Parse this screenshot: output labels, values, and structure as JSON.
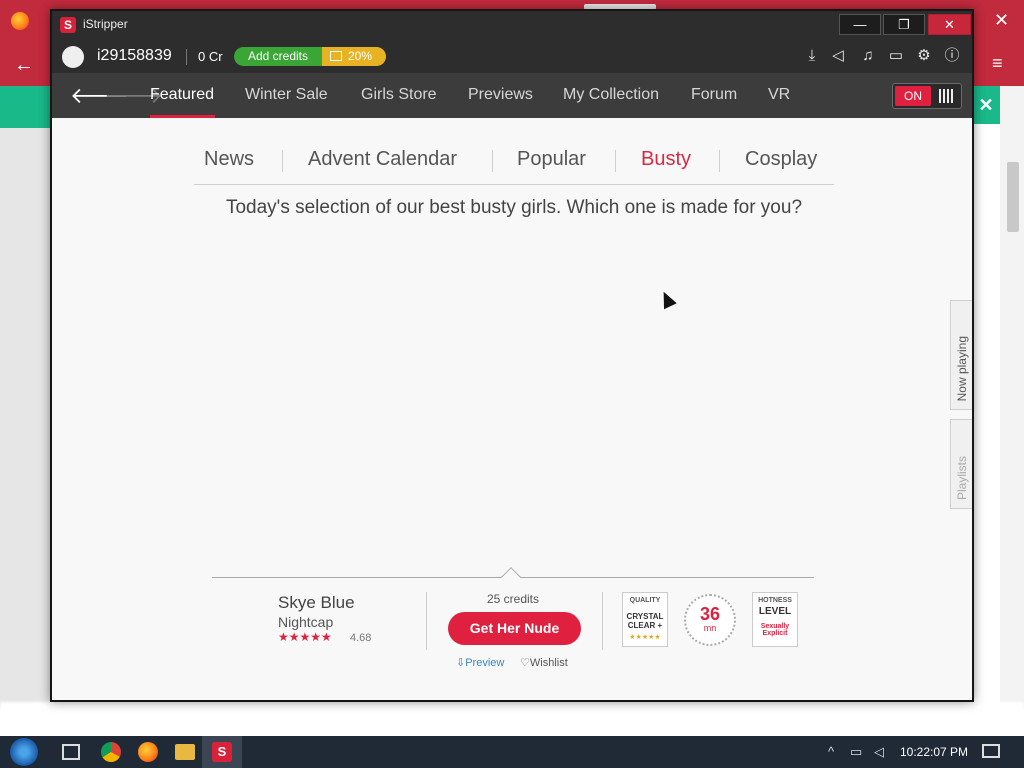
{
  "app": {
    "title": "iStripper",
    "logo_letter": "S",
    "window_controls": {
      "minimize": "—",
      "maximize": "❐",
      "close": "✕"
    }
  },
  "userbar": {
    "username": "i29158839",
    "credits": "0 Cr",
    "add_credits_label": "Add credits",
    "discount_label": "20%",
    "icons": [
      "download-icon",
      "speaker-icon",
      "music-icon",
      "monitor-icon",
      "gear-icon",
      "info-icon"
    ]
  },
  "navbar": {
    "back": "🡐",
    "forward": "🡒",
    "items": [
      {
        "label": "Featured"
      },
      {
        "label": "Winter Sale"
      },
      {
        "label": "Girls Store"
      },
      {
        "label": "Previews"
      },
      {
        "label": "My Collection"
      },
      {
        "label": "Forum"
      },
      {
        "label": "VR"
      }
    ],
    "active_index": 0,
    "toggle_label": "ON"
  },
  "subtabs": {
    "items": [
      {
        "label": "News"
      },
      {
        "label": "Advent Calendar"
      },
      {
        "label": "Popular"
      },
      {
        "label": "Busty"
      },
      {
        "label": "Cosplay"
      }
    ],
    "active_index": 3
  },
  "tagline": "Today's selection of our best busty girls. Which one is made for you?",
  "side_tabs": {
    "now_playing": "Now playing",
    "playlists": "Playlists"
  },
  "card": {
    "name": "Skye Blue",
    "card_title": "Nightcap",
    "stars": "★★★★★",
    "rating": "4.68",
    "price": "25 credits",
    "cta_label": "Get Her Nude",
    "preview_label": "Preview",
    "wishlist_label": "Wishlist",
    "quality_badge": {
      "title": "QUALITY",
      "line1": "CRYSTAL",
      "line2": "CLEAR +",
      "stars": "★★★★★"
    },
    "duration": {
      "value": "36",
      "unit": "mn"
    },
    "hotness_badge": {
      "title": "HOTNESS",
      "level": "LEVEL",
      "line1": "Sexually",
      "line2": "Explicit"
    }
  },
  "taskbar": {
    "clock": "10:22:07 PM",
    "istripper_letter": "S"
  },
  "colors": {
    "accent": "#e0203f",
    "titlebar": "#2d2d2d",
    "navbar": "#3c3c3c",
    "add_credits": "#3aa636",
    "discount": "#e7b324"
  }
}
